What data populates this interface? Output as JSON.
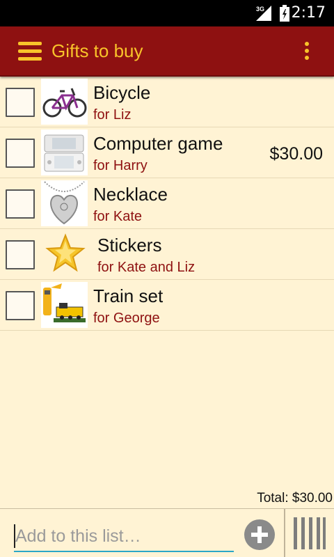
{
  "status_bar": {
    "network": "3G",
    "time": "2:17"
  },
  "app_bar": {
    "title": "Gifts to buy"
  },
  "items": [
    {
      "name": "Bicycle",
      "recipient": "for Liz",
      "price": ""
    },
    {
      "name": "Computer game",
      "recipient": "for Harry",
      "price": "$30.00"
    },
    {
      "name": "Necklace",
      "recipient": "for Kate",
      "price": ""
    },
    {
      "name": "Stickers",
      "recipient": "for Kate and Liz",
      "price": ""
    },
    {
      "name": "Train set",
      "recipient": "for George",
      "price": ""
    }
  ],
  "total": "Total: $30.00",
  "add_bar": {
    "placeholder": "Add to this list…"
  },
  "colors": {
    "app_bar": "#8e1111",
    "accent": "#f8c32a",
    "background": "#fff3d4",
    "recipient_text": "#8e1111",
    "input_underline": "#2aa6c7"
  }
}
